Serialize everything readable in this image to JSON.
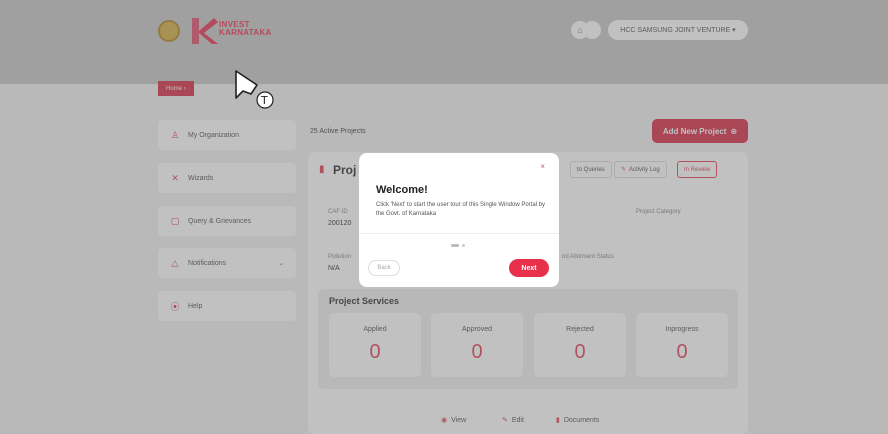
{
  "header": {
    "logo_line1": "INVEST",
    "logo_line2": "KARNATAKA",
    "user_menu_label": "HCC SAMSUNG JOINT VENTURE ▾"
  },
  "breadcrumb": {
    "home": "Home  ›"
  },
  "sidebar": {
    "items": [
      {
        "label": "My Organization",
        "icon": "♙"
      },
      {
        "label": "Wizards",
        "icon": "✕"
      },
      {
        "label": "Query & Grievances",
        "icon": "▢"
      },
      {
        "label": "Notifications",
        "icon": "△",
        "chevron": "⌄"
      },
      {
        "label": "Help",
        "icon": "⦿"
      }
    ]
  },
  "main": {
    "projects_count": "25  Active Projects",
    "add_project": "Add New Project",
    "add_project_icon": "⊕",
    "project": {
      "title_partial": "Proj",
      "chips": {
        "queries": "to Queries",
        "activity_log": "Activity Log",
        "status": "In Review"
      },
      "caf_id_label": "CAF ID",
      "caf_id_value": "200120",
      "project_category_label": "Project Category",
      "pollution_label": "Pollution",
      "pollution_value": "N/A",
      "allotment_status_label": "nd Allotment Status"
    },
    "services": {
      "title": "Project Services",
      "stats": [
        {
          "label": "Applied",
          "value": "0"
        },
        {
          "label": "Approved",
          "value": "0"
        },
        {
          "label": "Rejected",
          "value": "0"
        },
        {
          "label": "Inprogress",
          "value": "0"
        }
      ]
    },
    "actions": {
      "view": "View",
      "edit": "Edit",
      "documents": "Documents"
    }
  },
  "modal": {
    "close": "×",
    "title": "Welcome!",
    "text": "Click 'Next' to start the user tour of this Single Window Portal by the Govt. of Karnataka",
    "back": "Back",
    "next": "Next"
  },
  "colors": {
    "accent": "#d9344d",
    "header_bg": "#c9c9c9"
  }
}
